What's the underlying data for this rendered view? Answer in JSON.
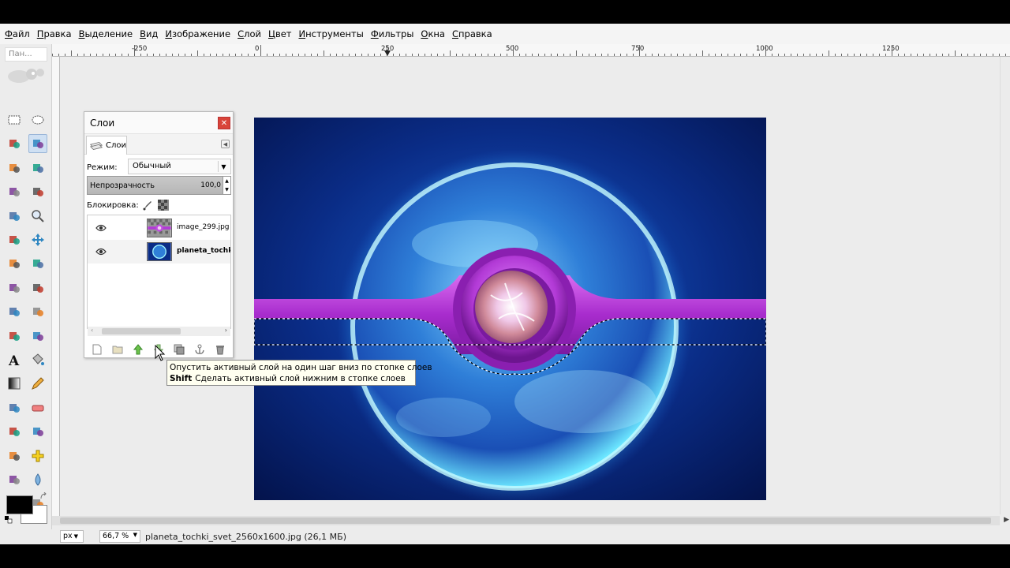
{
  "menu": {
    "items": [
      "Файл",
      "Правка",
      "Выделение",
      "Вид",
      "Изображение",
      "Слой",
      "Цвет",
      "Инструменты",
      "Фильтры",
      "Окна",
      "Справка"
    ]
  },
  "toolbox": {
    "title": "Пан...",
    "tools": [
      "rect-select",
      "ellipse-select",
      "free-select",
      "fuzzy-select",
      "color-select",
      "scissors",
      "foreground-select",
      "paths",
      "color-picker",
      "zoom",
      "measure",
      "move",
      "align",
      "crop",
      "rotate",
      "scale",
      "shear",
      "perspective",
      "flip",
      "cage",
      "text",
      "bucket-fill",
      "blend",
      "pencil",
      "paintbrush",
      "eraser",
      "airbrush",
      "ink",
      "clone",
      "heal",
      "perspective-clone",
      "blur",
      "smudge",
      "dodge-burn"
    ],
    "foreground_color": "#000000",
    "background_color": "#ffffff"
  },
  "ruler": {
    "labels": [
      "-250",
      "0",
      "250",
      "500",
      "750",
      "1000",
      "1250"
    ]
  },
  "layers_dialog": {
    "title": "Слои",
    "tab_label": "Слои",
    "mode_label": "Режим:",
    "mode_value": "Обычный",
    "opacity_label": "Непрозрачность",
    "opacity_value": "100,0",
    "lock_label": "Блокировка:",
    "layers": [
      {
        "name": "image_299.jpg",
        "visible": true,
        "active": false
      },
      {
        "name": "planeta_tochki_s",
        "visible": true,
        "active": true
      }
    ]
  },
  "tooltip": {
    "line1": "Опустить активный слой на один шаг вниз по стопке слоев",
    "line2_key": "Shift",
    "line2_text": "Сделать активный слой нижним в стопке слоев"
  },
  "statusbar": {
    "unit": "px",
    "zoom": "66,7 %",
    "file_info": "planeta_tochki_svet_2560x1600.jpg (26,1 МБ)"
  },
  "colors": {
    "selection_accent": "#cfe0f3",
    "close_button": "#d9443a",
    "tooltip_bg": "#fffff0",
    "ring_purple": "#b23ad6"
  }
}
